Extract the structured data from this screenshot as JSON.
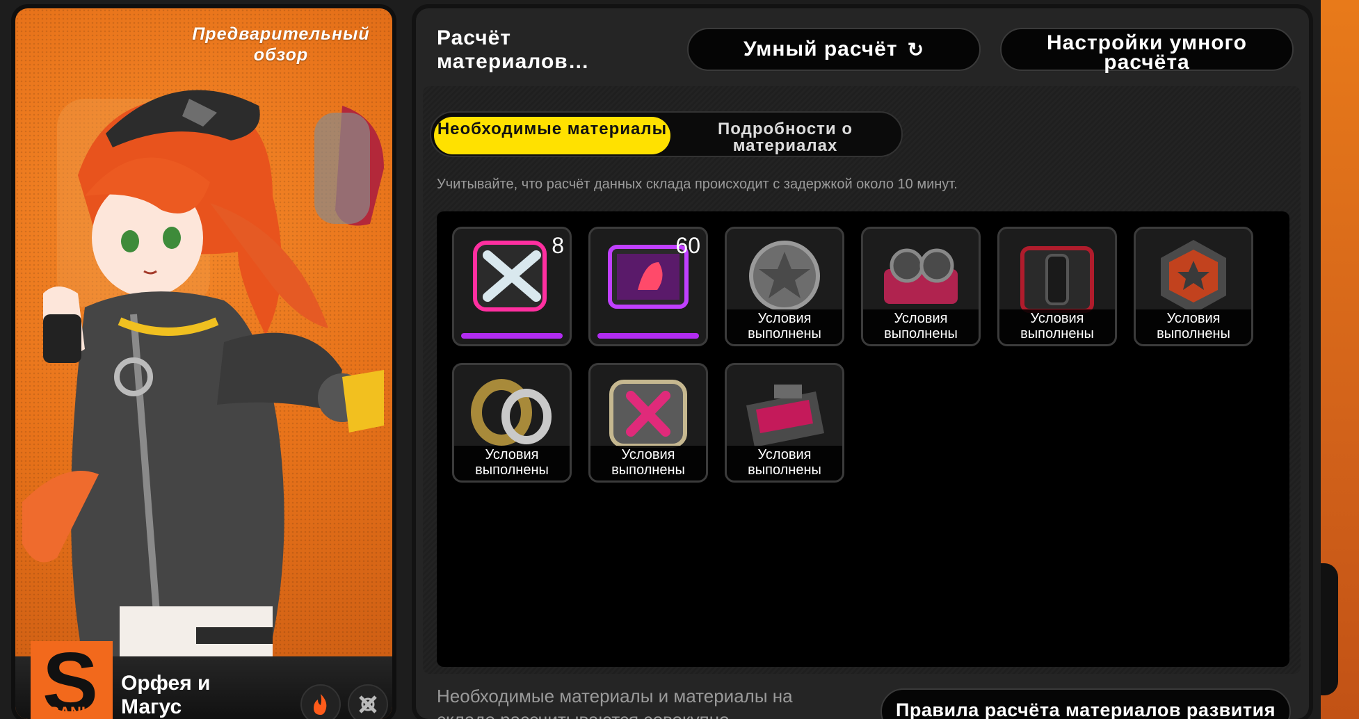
{
  "character": {
    "preview_label": "Предварительный обзор",
    "name": "Орфея и Магус",
    "rank": "S",
    "rank_text": "RANK",
    "element_icon": "fire-icon",
    "class_icon": "attack-icon",
    "bg_color": "#e8731a"
  },
  "panel": {
    "title": "Расчёт материалов…",
    "smart_calc_label": "Умный расчёт",
    "smart_settings_label": "Настройки умного расчёта",
    "tabs": [
      {
        "label": "Необходимые материалы",
        "active": true
      },
      {
        "label": "Подробности о материалах",
        "active": false
      }
    ],
    "notice": "Учитывайте, что расчёт данных склада происходит с задержкой около 10 минут.",
    "accent": "#ffe100"
  },
  "materials": [
    {
      "icon": "pink-crossed-blades-chip-icon",
      "count": "8",
      "status": ""
    },
    {
      "icon": "purple-creature-disk-icon",
      "count": "60",
      "status": ""
    },
    {
      "icon": "silver-star-coin-icon",
      "count": "",
      "status": "Условия выполнены"
    },
    {
      "icon": "pink-twin-reel-drive-icon",
      "count": "",
      "status": "Условия выполнены"
    },
    {
      "icon": "red-black-core-icon",
      "count": "",
      "status": "Условия выполнены"
    },
    {
      "icon": "red-hexagon-emblem-icon",
      "count": "",
      "status": "Условия выполнены"
    },
    {
      "icon": "gold-silver-ring-icon",
      "count": "",
      "status": "Условия выполнены"
    },
    {
      "icon": "pink-x-chip-icon",
      "count": "",
      "status": "Условия выполнены"
    },
    {
      "icon": "pink-data-cartridge-icon",
      "count": "",
      "status": "Условия выполнены"
    }
  ],
  "footer": {
    "text": "Необходимые материалы и материалы на складе рассчитываются совокупно",
    "rules_label": "Правила расчёта материалов развития"
  }
}
